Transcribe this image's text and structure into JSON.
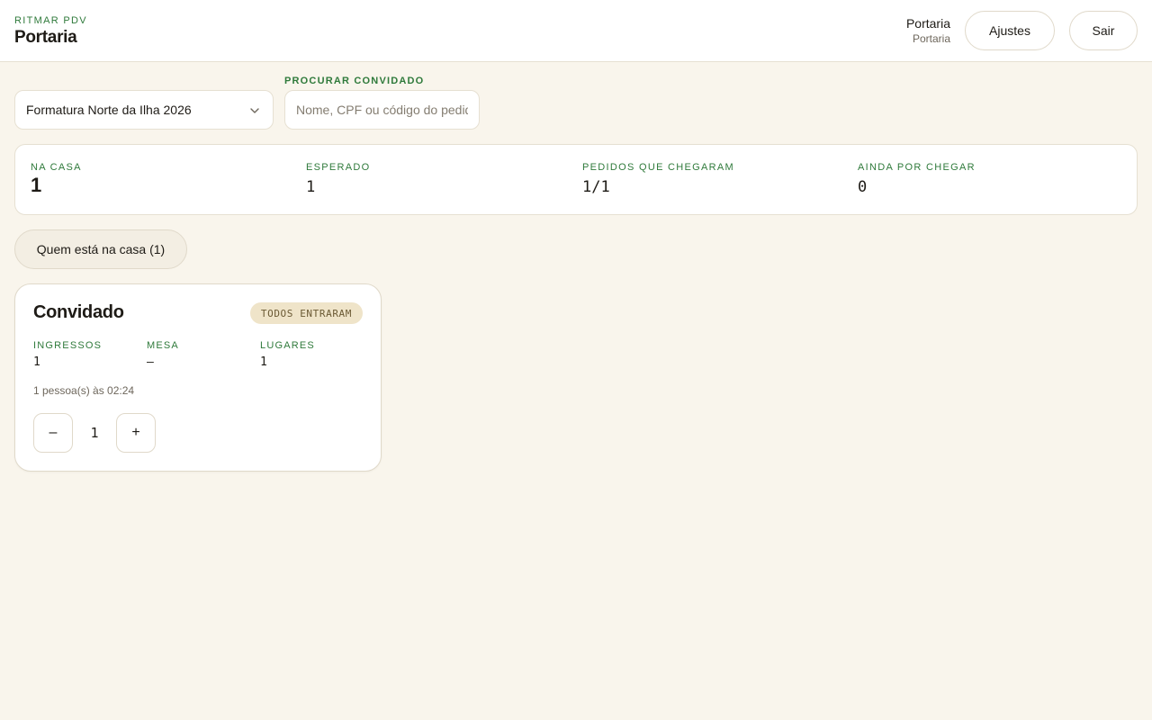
{
  "header": {
    "brand_kicker": "RITMAR PDV",
    "page_title": "Portaria",
    "user_name": "Portaria",
    "user_role": "Portaria",
    "settings_label": "Ajustes",
    "logout_label": "Sair"
  },
  "filters": {
    "event_selected": "Formatura Norte da Ilha 2026",
    "search_label": "PROCURAR CONVIDADO",
    "search_placeholder": "Nome, CPF ou código do pedido",
    "search_value": ""
  },
  "stats": [
    {
      "label": "NA CASA",
      "value": "1"
    },
    {
      "label": "ESPERADO",
      "value": "1"
    },
    {
      "label": "PEDIDOS QUE CHEGARAM",
      "value": "1/1"
    },
    {
      "label": "AINDA POR CHEGAR",
      "value": "0"
    }
  ],
  "tab": {
    "label": "Quem está na casa (1)"
  },
  "guest_card": {
    "title": "Convidado",
    "status_badge": "TODOS ENTRARAM",
    "fields": [
      {
        "label": "INGRESSOS",
        "value": "1"
      },
      {
        "label": "MESA",
        "value": "–"
      },
      {
        "label": "LUGARES",
        "value": "1"
      }
    ],
    "arrival_note": "1 pessoa(s) às 02:24",
    "stepper": {
      "minus": "–",
      "value": "1",
      "plus": "+"
    }
  },
  "colors": {
    "background": "#f9f5ec",
    "accent_green": "#2f7a3b",
    "badge_bg": "#efe4c9",
    "text": "#1e1b16"
  },
  "icons": {
    "event_select_chevron": "chevron-down-icon"
  }
}
